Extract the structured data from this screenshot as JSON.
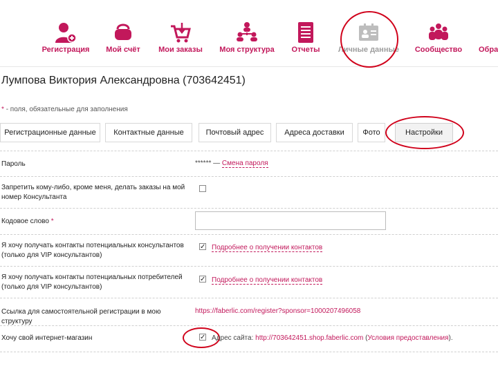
{
  "nav": {
    "items": [
      {
        "label": "Регистрация",
        "icon": "person-add-icon"
      },
      {
        "label": "Мой счёт",
        "icon": "wallet-icon"
      },
      {
        "label": "Мои заказы",
        "icon": "cart-icon"
      },
      {
        "label": "Моя структура",
        "icon": "structure-icon"
      },
      {
        "label": "Отчеты",
        "icon": "report-icon"
      },
      {
        "label": "Личные данные",
        "icon": "id-card-icon"
      },
      {
        "label": "Сообщество",
        "icon": "community-icon"
      },
      {
        "label": "Обра",
        "icon": "feedback-icon"
      }
    ]
  },
  "page": {
    "title": "Лумпова Виктория Александровна (703642451)",
    "required_note": "- поля, обязательные для заполнения"
  },
  "tabs": [
    {
      "label": "Регистрационные данные"
    },
    {
      "label": "Контактные данные"
    },
    {
      "label": "Почтовый адрес"
    },
    {
      "label": "Адреса доставки"
    },
    {
      "label": "Фото"
    },
    {
      "label": "Настройки"
    }
  ],
  "settings": {
    "password": {
      "label": "Пароль",
      "value": "****** —",
      "link": "Смена пароля"
    },
    "forbid_orders": {
      "label": "Запретить кому-либо, кроме меня, делать заказы на мой номер Консультанта",
      "checked": false
    },
    "code_word": {
      "label": "Кодовое слово",
      "asterisk": "*",
      "value": ""
    },
    "consultant_contacts": {
      "label": "Я хочу получать контакты потенциальных консультантов (только для VIP консультантов)",
      "checked": true,
      "link": "Подробнее о получении контактов"
    },
    "customer_contacts": {
      "label": "Я хочу получать контакты потенциальных потребителей (только для VIP консультантов)",
      "checked": true,
      "link": "Подробнее о получении контактов"
    },
    "self_reg_link": {
      "label": "Ссылка для самостоятельной регистрации в мою структуру",
      "value": "https://faberlic.com/register?sponsor=1000207496058"
    },
    "shop": {
      "label": "Хочу свой интернет-магазин",
      "checked": true,
      "address_prefix": "Адрес сайта:",
      "url": "http://703642451.shop.faberlic.com",
      "paren_open": "(",
      "terms": "Условия предоставления",
      "paren_close": ")."
    }
  },
  "colors": {
    "accent": "#c2185b",
    "annotation": "#d0021b"
  }
}
